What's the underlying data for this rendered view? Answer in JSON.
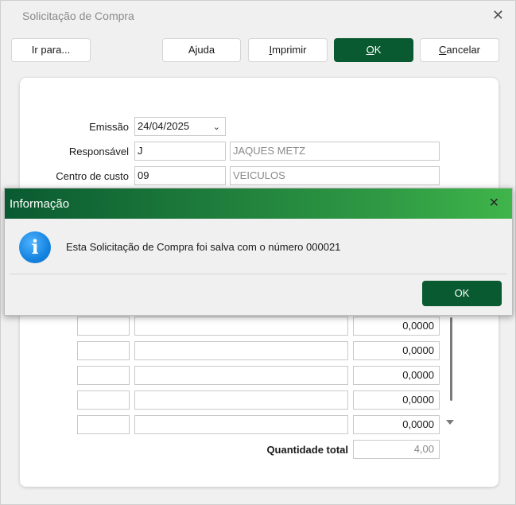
{
  "window": {
    "title": "Solicitação de Compra"
  },
  "toolbar": {
    "goto_label": "Ir para...",
    "help_label": "Ajuda",
    "print_label_first": "I",
    "print_label_rest": "mprimir",
    "ok_label_first": "O",
    "ok_label_rest": "K",
    "cancel_label_first": "C",
    "cancel_label_rest": "ancelar"
  },
  "form": {
    "emissao_label": "Emissão",
    "emissao_value": "24/04/2025",
    "responsavel_label": "Responsável",
    "responsavel_code": "J",
    "responsavel_name": "JAQUES METZ",
    "centro_label": "Centro de custo",
    "centro_code": "09",
    "centro_name": "VEICULOS"
  },
  "items": {
    "rows": [
      {
        "code": "",
        "description": "",
        "quantity": "0,0000"
      },
      {
        "code": "",
        "description": "",
        "quantity": "0,0000"
      },
      {
        "code": "",
        "description": "",
        "quantity": "0,0000"
      },
      {
        "code": "",
        "description": "",
        "quantity": "0,0000"
      },
      {
        "code": "",
        "description": "",
        "quantity": "0,0000"
      }
    ],
    "total_label": "Quantidade total",
    "total_value": "4,00"
  },
  "dialog": {
    "title": "Informação",
    "message": "Esta Solicitação de Compra foi salva com o número 000021",
    "ok_label": "OK",
    "icon": "info-icon"
  },
  "colors": {
    "primary": "#0a5a31",
    "dialog_header_start": "#0a5a31",
    "dialog_header_end": "#3fb54a",
    "info_icon": "#1584e0"
  }
}
